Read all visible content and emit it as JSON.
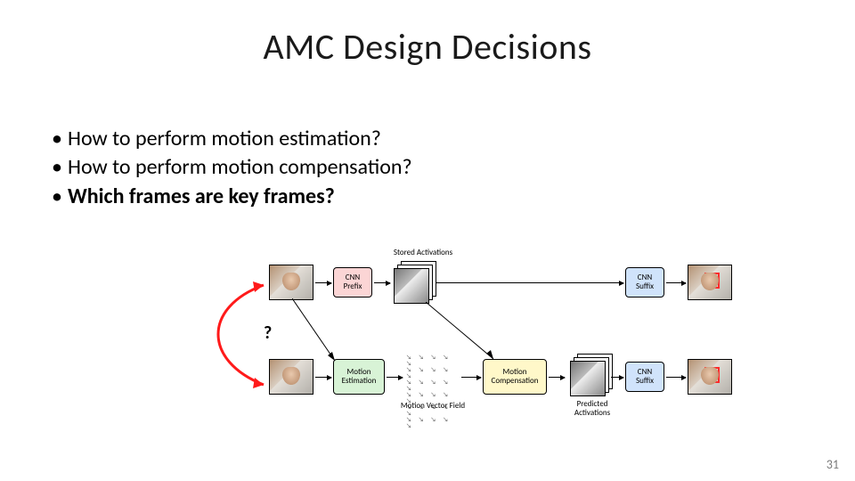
{
  "title": "AMC Design Decisions",
  "bullets": [
    {
      "text": "How to perform motion estimation?",
      "bold": false
    },
    {
      "text": "How to perform motion compensation?",
      "bold": false
    },
    {
      "text": "Which frames are key frames?",
      "bold": true
    }
  ],
  "qmark": "?",
  "diagram": {
    "stored_activations": "Stored Activations",
    "cnn_prefix": "CNN Prefix",
    "cnn_suffix": "CNN Suffix",
    "motion_estimation": "Motion Estimation",
    "motion_compensation": "Motion Compensation",
    "motion_vector_field": "Motion Vector Field",
    "predicted_activations": "Predicted Activations"
  },
  "page_number": "31"
}
